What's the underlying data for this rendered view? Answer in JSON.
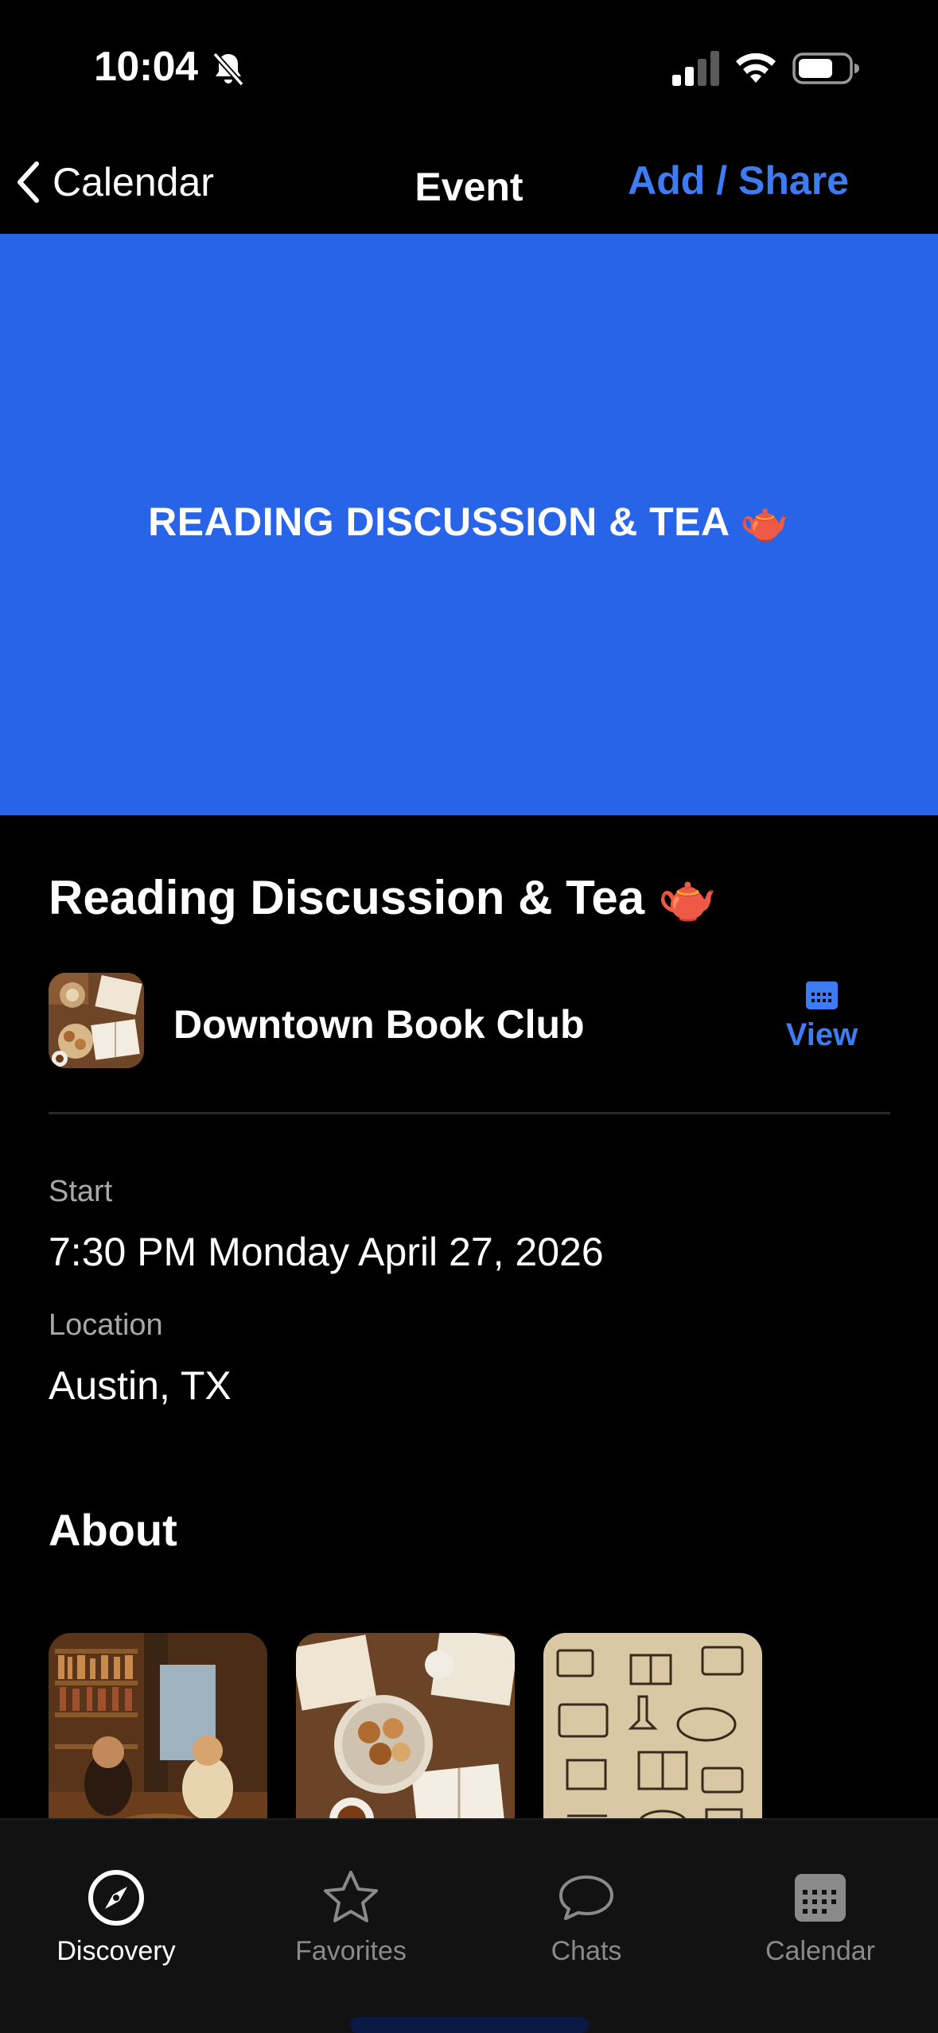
{
  "status_bar": {
    "time": "10:04"
  },
  "nav": {
    "back_label": "Calendar",
    "title": "Event",
    "action_label": "Add / Share"
  },
  "banner": {
    "text": "READING DISCUSSION & TEA 🫖",
    "color": "#2864e8"
  },
  "event": {
    "title": "Reading Discussion & Tea 🫖",
    "organizer": "Downtown Book Club",
    "view_label": "View",
    "start_label": "Start",
    "start_value": "7:30 PM Monday April 27, 2026",
    "location_label": "Location",
    "location_value": "Austin, TX",
    "about_heading": "About"
  },
  "gallery": [
    {
      "icon": "bookstore-photo"
    },
    {
      "icon": "tea-and-books-photo"
    },
    {
      "icon": "book-club-doodle-photo"
    }
  ],
  "tabbar": {
    "tabs": [
      {
        "label": "Discovery",
        "icon": "compass-icon",
        "active": true
      },
      {
        "label": "Favorites",
        "icon": "star-icon",
        "active": false
      },
      {
        "label": "Chats",
        "icon": "chat-bubble-icon",
        "active": false
      },
      {
        "label": "Calendar",
        "icon": "calendar-icon",
        "active": false
      }
    ]
  },
  "colors": {
    "accent": "#3e7cf6",
    "background": "#000000"
  }
}
